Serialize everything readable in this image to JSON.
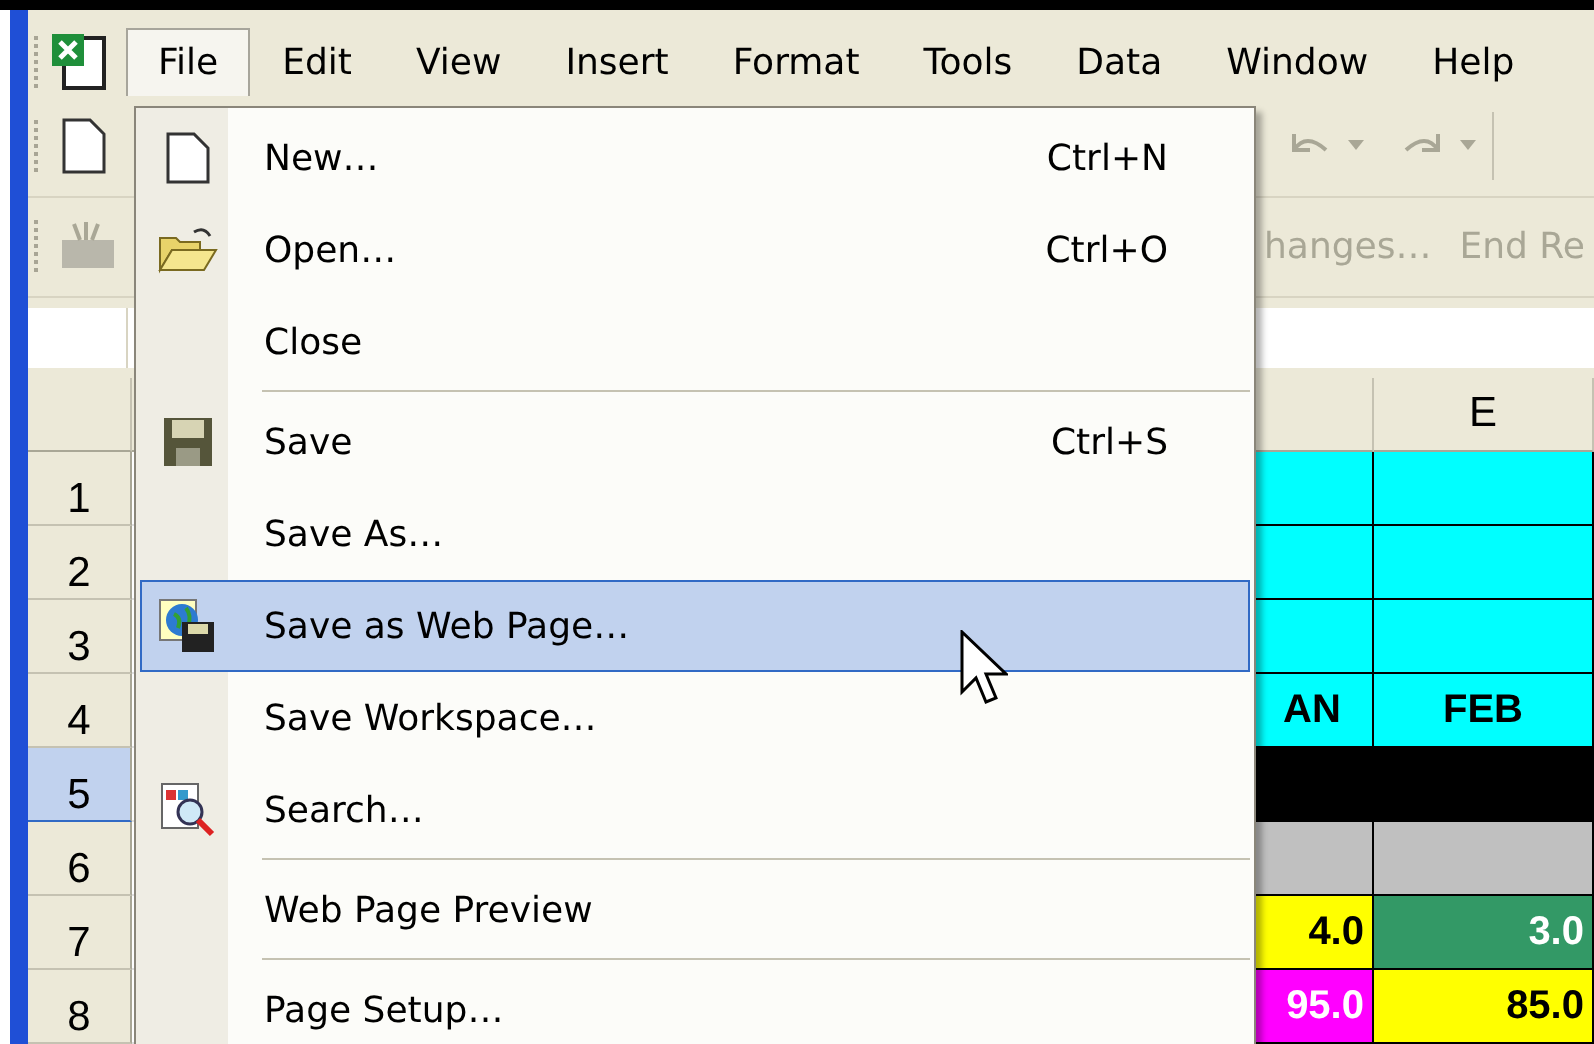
{
  "menu_bar": {
    "items": [
      {
        "label": "File",
        "selected": true
      },
      {
        "label": "Edit",
        "selected": false
      },
      {
        "label": "View",
        "selected": false
      },
      {
        "label": "Insert",
        "selected": false
      },
      {
        "label": "Format",
        "selected": false
      },
      {
        "label": "Tools",
        "selected": false
      },
      {
        "label": "Data",
        "selected": false
      },
      {
        "label": "Window",
        "selected": false
      },
      {
        "label": "Help",
        "selected": false
      }
    ]
  },
  "reviewing_toolbar": {
    "items": [
      "hanges…",
      "End Re"
    ]
  },
  "sheet": {
    "column_headers": [
      "E"
    ],
    "rows": [
      {
        "header": "1",
        "selected": false,
        "cells": [
          {
            "text": "",
            "color": "#00ffff"
          },
          {
            "text": "",
            "color": "#00ffff"
          }
        ]
      },
      {
        "header": "2",
        "selected": false,
        "cells": [
          {
            "text": "",
            "color": "#00ffff"
          },
          {
            "text": "",
            "color": "#00ffff"
          }
        ]
      },
      {
        "header": "3",
        "selected": false,
        "cells": [
          {
            "text": "",
            "color": "#00ffff"
          },
          {
            "text": "",
            "color": "#00ffff"
          }
        ]
      },
      {
        "header": "4",
        "selected": false,
        "cells": [
          {
            "text": "AN",
            "color": "#00ffff"
          },
          {
            "text": "FEB",
            "color": "#00ffff"
          }
        ]
      },
      {
        "header": "5",
        "selected": true,
        "cells": [
          {
            "text": "",
            "color": "#000000"
          },
          {
            "text": "",
            "color": "#000000"
          }
        ]
      },
      {
        "header": "6",
        "selected": false,
        "cells": [
          {
            "text": "",
            "color": "#c0c0c0"
          },
          {
            "text": "",
            "color": "#c0c0c0"
          }
        ]
      },
      {
        "header": "7",
        "selected": false,
        "cells": [
          {
            "text": "4.0",
            "color": "#ffff00"
          },
          {
            "text": "3.0",
            "color": "#339966"
          }
        ]
      },
      {
        "header": "8",
        "selected": false,
        "cells": [
          {
            "text": "95.0",
            "color": "#ff00ff"
          },
          {
            "text": "85.0",
            "color": "#ffff00"
          }
        ]
      }
    ]
  },
  "file_menu": {
    "items": [
      {
        "kind": "item",
        "label": "New…",
        "shortcut": "Ctrl+N",
        "highlighted": false
      },
      {
        "kind": "item",
        "label": "Open…",
        "shortcut": "Ctrl+O",
        "highlighted": false
      },
      {
        "kind": "item",
        "label": "Close",
        "highlighted": false
      },
      {
        "kind": "separator"
      },
      {
        "kind": "item",
        "label": "Save",
        "shortcut": "Ctrl+S",
        "highlighted": false
      },
      {
        "kind": "item",
        "label": "Save As…",
        "highlighted": false
      },
      {
        "kind": "item",
        "label": "Save as Web Page…",
        "highlighted": true
      },
      {
        "kind": "item",
        "label": "Save Workspace…",
        "highlighted": false
      },
      {
        "kind": "item",
        "label": "Search…",
        "highlighted": false
      },
      {
        "kind": "separator"
      },
      {
        "kind": "item",
        "label": "Web Page Preview",
        "highlighted": false
      },
      {
        "kind": "separator"
      },
      {
        "kind": "item",
        "label": "Page Setup…",
        "highlighted": false
      }
    ]
  }
}
